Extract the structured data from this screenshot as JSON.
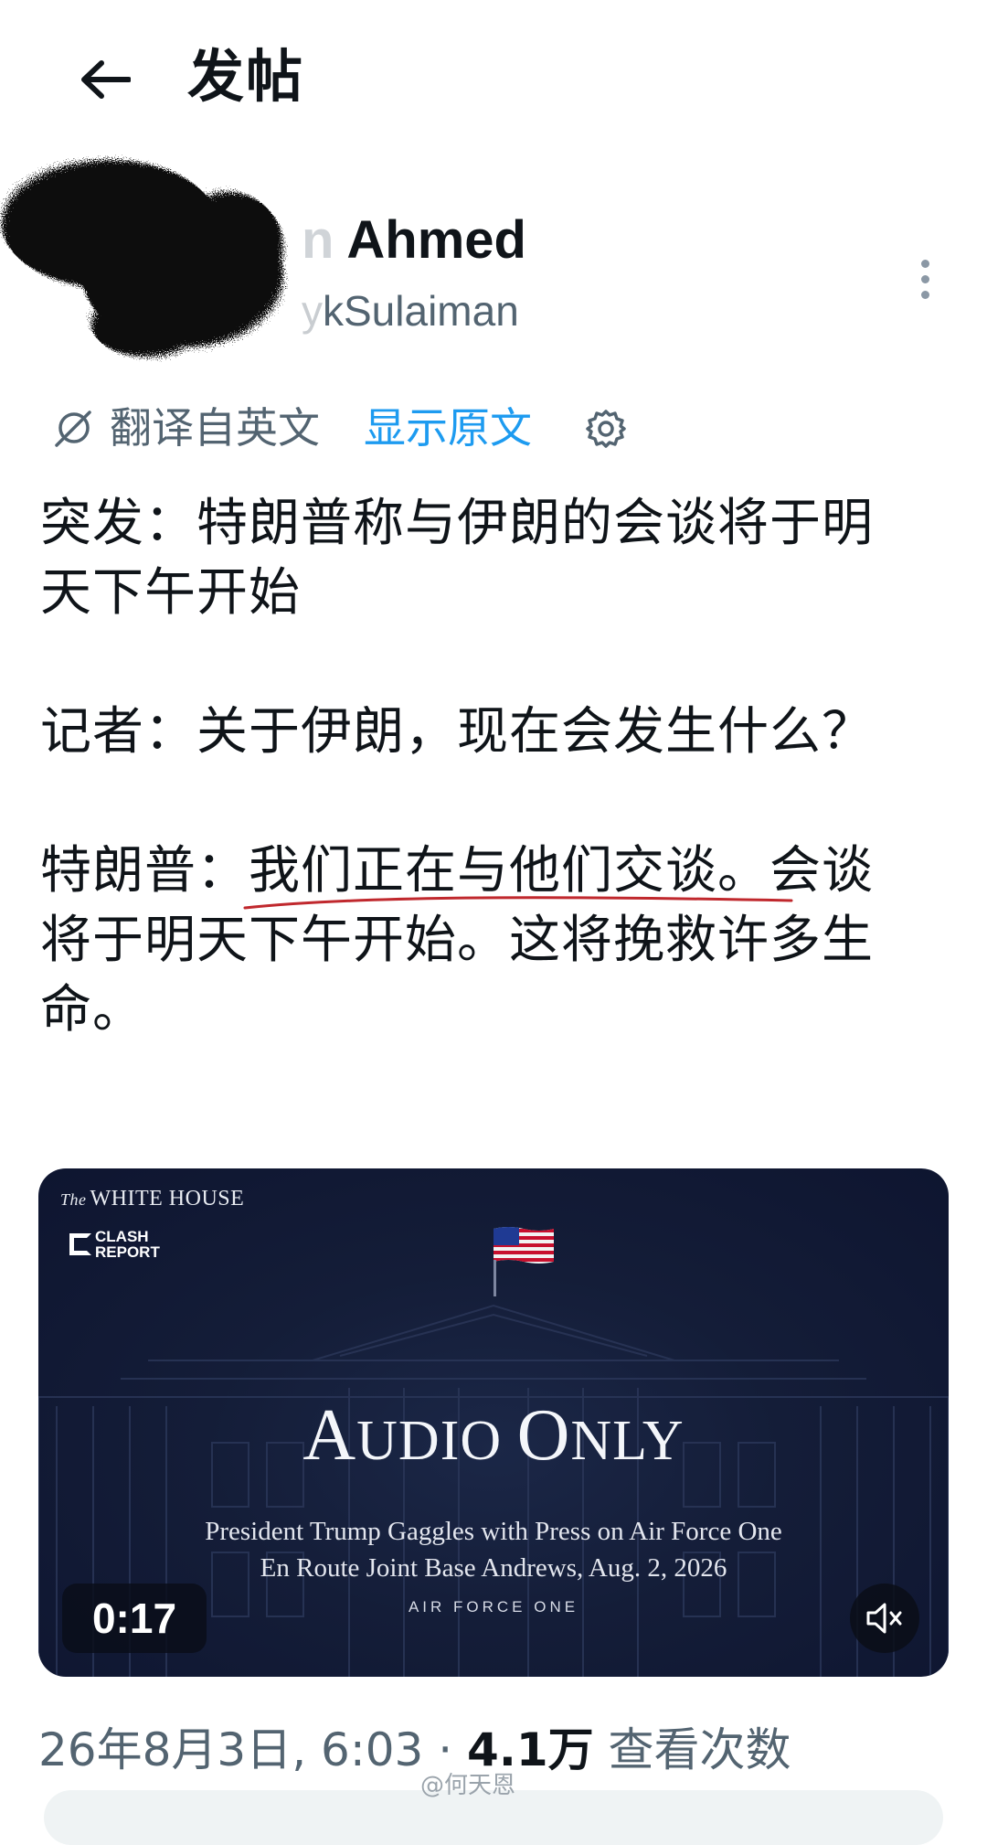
{
  "header": {
    "title": "发帖",
    "back_icon": "arrow-left-icon"
  },
  "author": {
    "display_name_visible": "Ahmed",
    "display_name_faded": "n ",
    "handle_faded": "y",
    "handle_visible": "kSulaiman",
    "more_icon": "more-vertical-icon"
  },
  "translation": {
    "label": "翻译自英文",
    "show_original": "显示原文",
    "icon": "translate-icon",
    "settings_icon": "gear-icon"
  },
  "tweet": {
    "p1": "突发：特朗普称与伊朗的会谈将于明天下午开始",
    "p2": "记者：关于伊朗，现在会发生什么？",
    "p3_prefix": "特朗普：",
    "p3_underlined": "我们正在与他们交谈。",
    "p3_rest": "会谈将于明天下午开始。这将挽救许多生命。",
    "underline_color": "#c0282d"
  },
  "media": {
    "logo_the": "The",
    "logo_wh": "WHITE HOUSE",
    "clash_line1": "CLASH",
    "clash_line2": "REPORT",
    "title_a": "A",
    "title_udio": "UDIO ",
    "title_o": "O",
    "title_nly": "NLY",
    "subtitle1": "President Trump Gaggles with Press on Air Force One",
    "subtitle2": "En Route Joint Base Andrews, Aug. 2, 2026",
    "caption": "AIR FORCE ONE",
    "duration": "0:17",
    "mute_icon": "volume-mute-icon",
    "bg_color": "#141d38"
  },
  "meta": {
    "date": "26年8月3日, 6:03",
    "separator1": "·",
    "separator2": "·",
    "views_count": "4.1万",
    "views_label": "查看次数"
  },
  "watermark": "@何天恩"
}
